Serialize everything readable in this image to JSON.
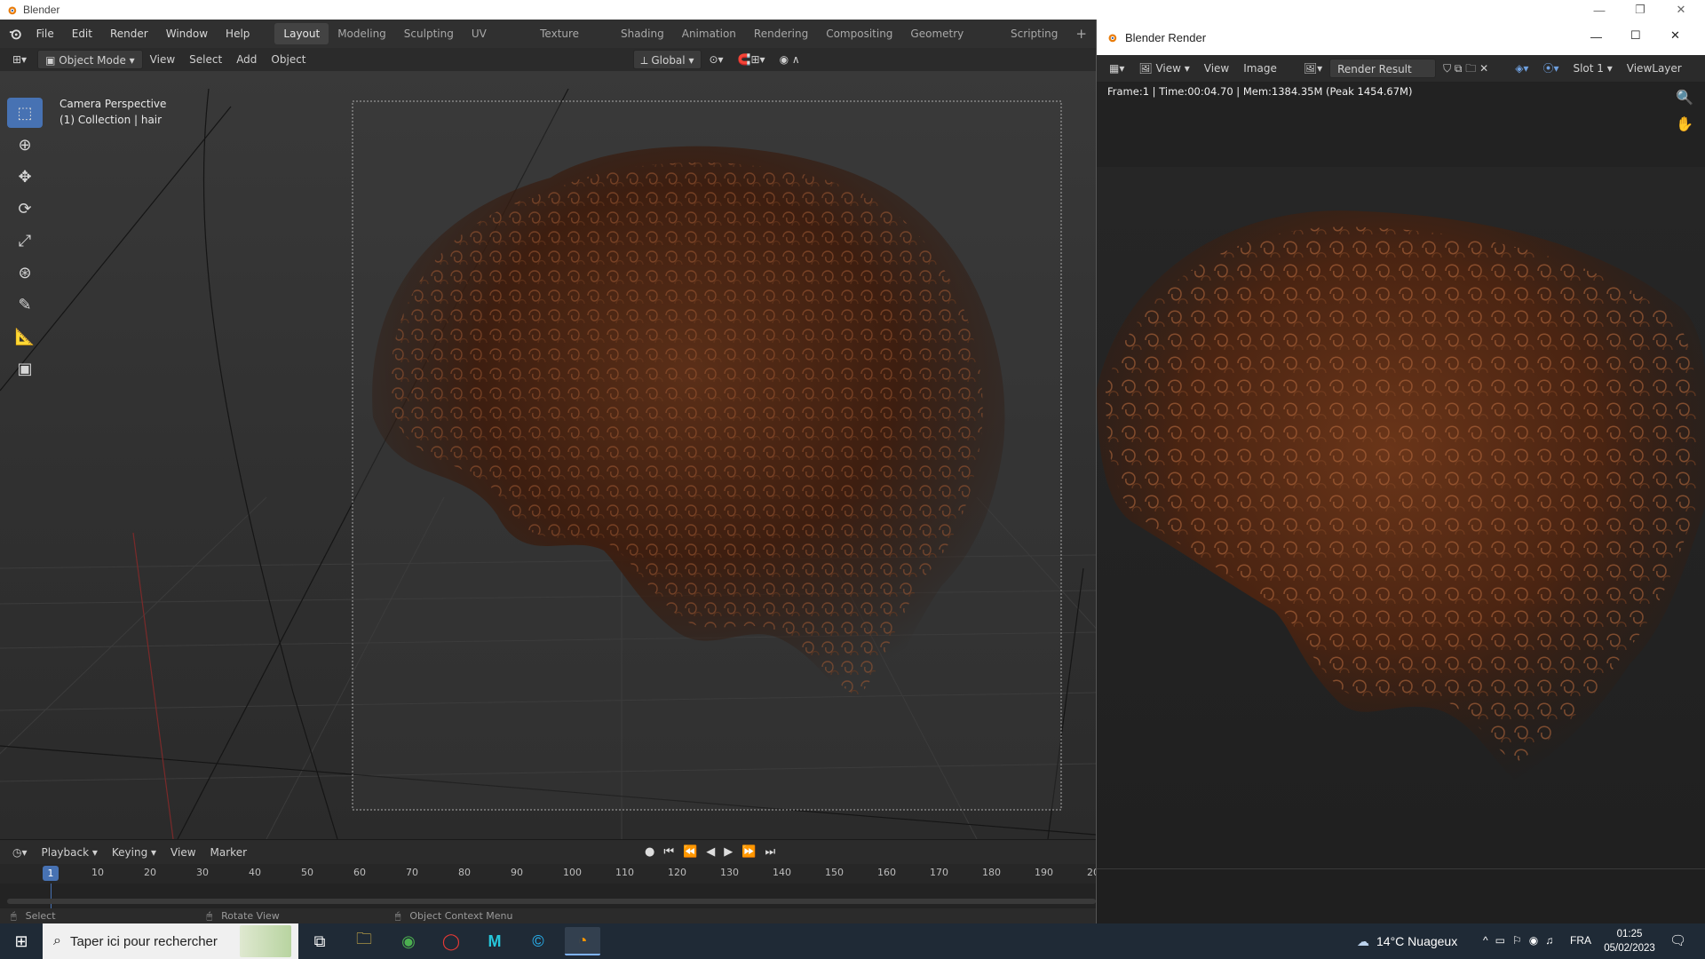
{
  "os": {
    "title": "Blender",
    "min": "—",
    "restore": "❐",
    "close": "✕"
  },
  "topbar": {
    "menus": [
      "File",
      "Edit",
      "Render",
      "Window",
      "Help"
    ],
    "workspaces": [
      "Layout",
      "Modeling",
      "Sculpting",
      "UV Editing",
      "Texture Paint",
      "Shading",
      "Animation",
      "Rendering",
      "Compositing",
      "Geometry Nodes",
      "Scripting"
    ],
    "active_workspace": "Layout",
    "add": "+"
  },
  "viewport_header": {
    "mode": "Object Mode",
    "menus": [
      "View",
      "Select",
      "Add",
      "Object"
    ],
    "orientation": "Global"
  },
  "viewport": {
    "overlay_line1": "Camera Perspective",
    "overlay_line2": "(1) Collection | hair"
  },
  "render_window": {
    "title": "Blender Render",
    "view_label": "View",
    "menus": [
      "View",
      "Image"
    ],
    "image_name": "Render Result",
    "slot": "Slot 1",
    "view_layer": "ViewLayer",
    "info": "Frame:1 | Time:00:04.70 | Mem:1384.35M (Peak 1454.67M)"
  },
  "timeline": {
    "menus": [
      "Playback",
      "Keying",
      "View",
      "Marker"
    ],
    "current_frame": "1",
    "ticks": [
      "10",
      "20",
      "30",
      "40",
      "50",
      "60",
      "70",
      "80",
      "90",
      "100",
      "110",
      "120",
      "130",
      "140",
      "150",
      "160",
      "170",
      "180",
      "190",
      "20"
    ]
  },
  "statusbar": {
    "left": "Select",
    "middle": "Rotate View",
    "right": "Object Context Menu"
  },
  "taskbar": {
    "search_placeholder": "Taper ici pour rechercher",
    "weather": "14°C  Nuageux",
    "lang": "FRA",
    "time": "01:25",
    "date": "05/02/2023"
  },
  "colors": {
    "accent": "#4772b3",
    "hair_dark": "#3a1d10",
    "hair_light": "#8a4a26"
  }
}
